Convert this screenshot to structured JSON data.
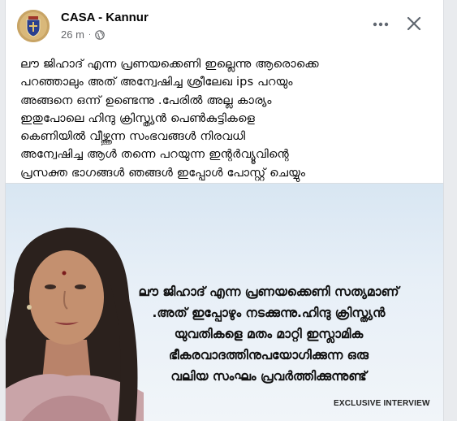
{
  "post": {
    "author": "CASA - Kannur",
    "time": "26 m",
    "separator": "·",
    "privacy_icon": "globe-icon",
    "text_lines": [
      "ലൗ ജിഹാദ് എന്ന പ്രണയക്കെണി ഇല്ലെന്നു ആരൊക്കെ",
      "പറഞ്ഞാലും അത് അന്വേഷിച്ച ശ്രീലേഖ ips പറയും",
      "അങ്ങനെ ഒന്ന് ഉണ്ടെന്നു .പേരിൽ അല്ല കാര്യം",
      "ഇതുപോലെ ഹിന്ദു ക്രിസ്ത്യൻ പെൺകുട്ടികളെ",
      "കെണിയിൽ വീഴ്ത്തുന്ന സംഭവങ്ങൾ നിരവധി",
      "അന്വേഷിച്ച ആൾ തന്നെ പറയുന്ന ഇന്റർവ്യൂവിന്റെ",
      "പ്രസക്ത ഭാഗങ്ങൾ ഞങ്ങൾ ഇപ്പോൾ പോസ്റ്റ് ചെയ്യും"
    ]
  },
  "image": {
    "quote_lines": [
      "ലൗ ജിഹാദ് എന്ന പ്രണയക്കെണി സത്യമാണ്",
      ".അത് ഇപ്പോഴും നടക്കുന്നു.ഹിന്ദു ക്രിസ്ത്യൻ",
      "യുവതികളെ മതം മാറ്റി ഇസ്ലാമിക",
      "ഭീകരവാദത്തിനുപയോഗിക്കുന്ന ഒരു",
      "വലിയ സംഘം പ്രവർത്തിക്കുന്നുണ്ട്"
    ],
    "tag": "EXCLUSIVE INTERVIEW"
  },
  "icons": {
    "more": "more-horizontal-icon",
    "close": "close-icon"
  },
  "colors": {
    "text": "#050505",
    "secondary": "#65676b",
    "image_bg": "#e7eff7"
  }
}
